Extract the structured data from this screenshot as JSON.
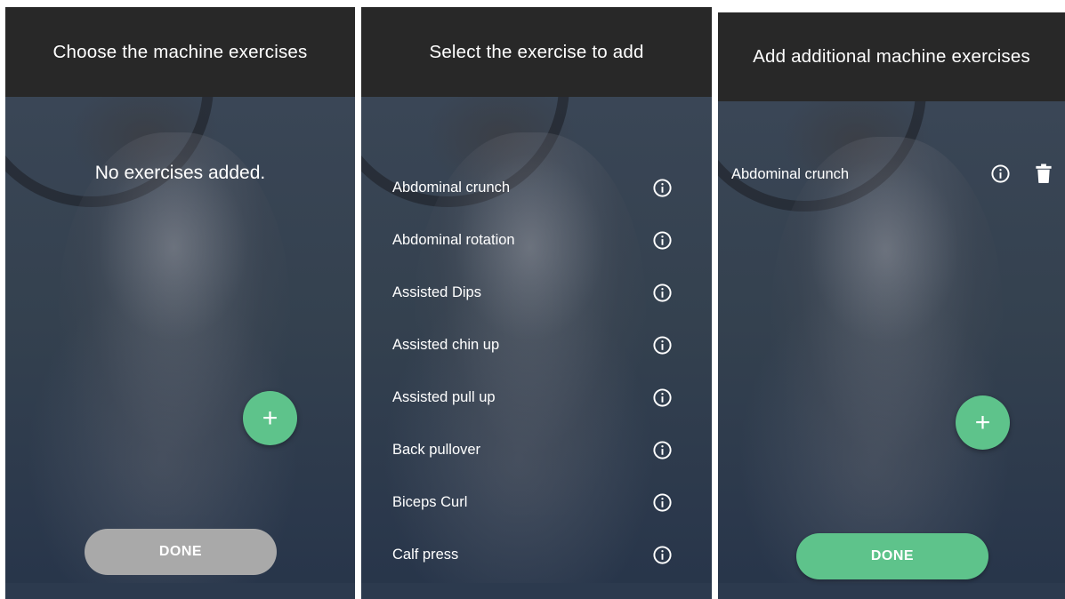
{
  "screen_left": {
    "title": "Choose the machine exercises",
    "empty_message": "No exercises added.",
    "fab_label": "+",
    "done_label": "DONE",
    "done_state": "disabled"
  },
  "screen_middle": {
    "title": "Select the exercise to add",
    "exercises": [
      {
        "name": "Abdominal crunch"
      },
      {
        "name": "Abdominal rotation"
      },
      {
        "name": "Assisted Dips"
      },
      {
        "name": "Assisted chin up"
      },
      {
        "name": "Assisted pull up"
      },
      {
        "name": "Back pullover"
      },
      {
        "name": "Biceps Curl"
      },
      {
        "name": "Calf press"
      }
    ],
    "row_icon": "info-icon"
  },
  "screen_right": {
    "title": "Add additional machine exercises",
    "added_exercises": [
      {
        "name": "Abdominal crunch"
      }
    ],
    "row_icons": [
      "info-icon",
      "trash-icon"
    ],
    "fab_label": "+",
    "done_label": "DONE",
    "done_state": "enabled"
  },
  "colors": {
    "appbar": "#282828",
    "accent_green": "#5ec38b",
    "disabled_gray": "#a9a9a9",
    "background_overlay": "#2f3d52",
    "text": "#ffffff"
  }
}
